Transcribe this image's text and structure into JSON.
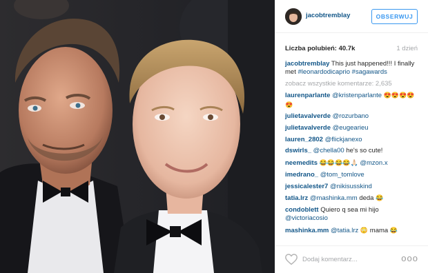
{
  "post": {
    "photo_alt": "",
    "header": {
      "username": "jacobtremblay",
      "follow_label": "OBSERWUJ"
    },
    "likes": {
      "label": "Liczba polubień:",
      "count": "40.7k",
      "time_ago": "1 dzień"
    },
    "caption": {
      "user": "jacobtremblay",
      "text": "This just happened!!! I finally met",
      "mention": "#leonardodicaprio",
      "hashtag": "#sagawards"
    },
    "view_all_comments": "zobacz wszystkie komentarze: 2,635",
    "comments": [
      {
        "user": "laurenparlante",
        "mention": "@kristenparlante",
        "text": "",
        "emoji": "😍😍😍😍😍"
      },
      {
        "user": "julietavalverde",
        "mention": "@rozurbano",
        "text": "",
        "emoji": ""
      },
      {
        "user": "julietavalverde",
        "mention": "@eugearieu",
        "text": "",
        "emoji": ""
      },
      {
        "user": "lauren_2802",
        "mention": "@flickjanexo",
        "text": "",
        "emoji": ""
      },
      {
        "user": "dswirls_",
        "mention": "@chella00",
        "text": "he's so cute!",
        "emoji": ""
      },
      {
        "user": "neemedits",
        "mention": "",
        "text": "",
        "emoji": "😂😂😂😂🙏🏻",
        "mention2": "@mzon.x"
      },
      {
        "user": "imedrano_",
        "mention": "@tom_tomlove",
        "text": "",
        "emoji": ""
      },
      {
        "user": "jessicalester7",
        "mention": "@nikisusskind",
        "text": "",
        "emoji": ""
      },
      {
        "user": "tatia.lrz",
        "mention": "@mashinka.mm",
        "text": "deda",
        "emoji": "😂"
      },
      {
        "user": "condoblett",
        "mention": "",
        "text": "Quiero q sea mi hijo",
        "emoji": "",
        "mention_after": "@victoriacosio"
      },
      {
        "user": "mashinka.mm",
        "mention": "@tatia.lrz",
        "text": "",
        "emoji": "😳",
        "text_after": "mama",
        "emoji_after": "😂"
      }
    ],
    "footer": {
      "add_comment_placeholder": "Dodaj komentarz...",
      "more_label": "ooo"
    }
  },
  "colors": {
    "link_blue": "#125688",
    "follow_blue": "#3897f0",
    "muted_gray": "#a5a7aa",
    "divider": "#efefef"
  },
  "icons": [
    "heart-icon",
    "more-options-icon"
  ]
}
